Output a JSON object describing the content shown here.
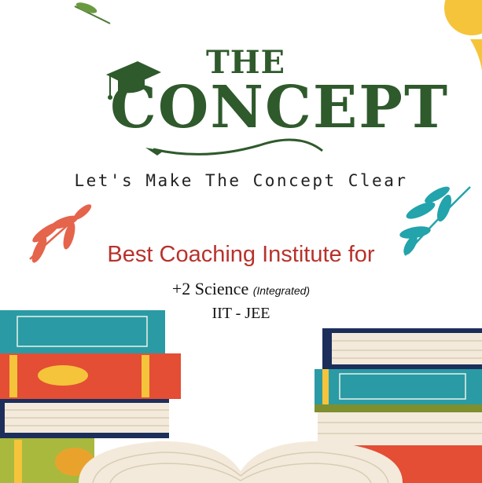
{
  "brand": {
    "title_small": "THE",
    "title_large": "CONCEPT",
    "tagline": "Let's Make The Concept Clear"
  },
  "promo": {
    "headline": "Best Coaching Institute for",
    "course_1": "+2 Science",
    "course_1_note": "(Integrated)",
    "course_2": "IIT - JEE"
  },
  "icons": [
    "graduation-cap-icon",
    "leaf-sprig-icon",
    "book-stack-icon",
    "open-book-icon"
  ],
  "colors": {
    "brand_green": "#2f5a2c",
    "headline_red": "#b8322c",
    "teal_book": "#2a9ba5",
    "red_book": "#e34e35",
    "navy_book": "#1c2f5b",
    "leaf_orange": "#e5644c",
    "leaf_teal": "#23a3ab",
    "accent_yellow": "#f5c43a"
  }
}
